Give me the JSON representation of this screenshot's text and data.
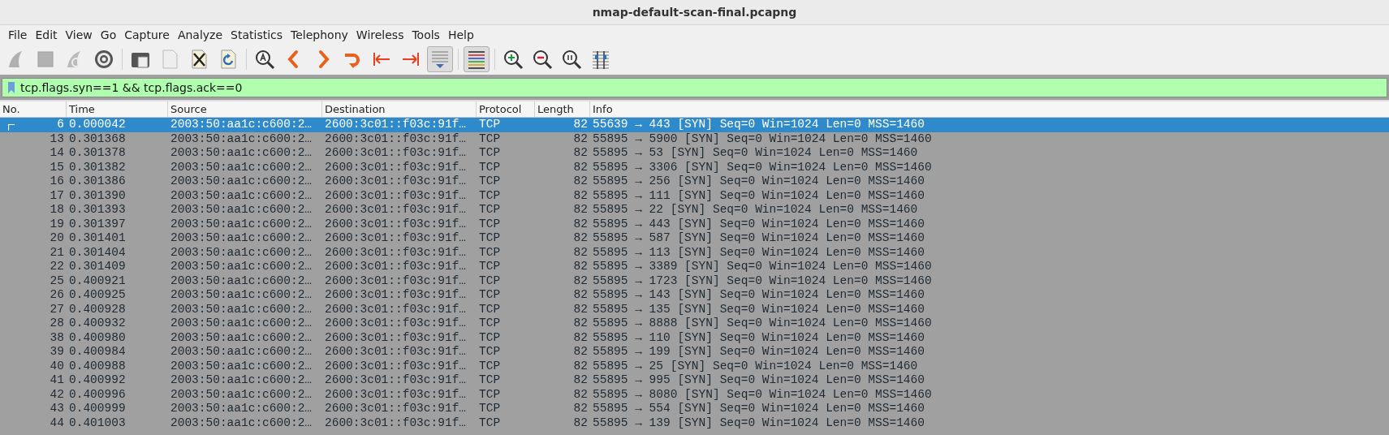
{
  "window": {
    "title": "nmap-default-scan-final.pcapng"
  },
  "menu": [
    "File",
    "Edit",
    "View",
    "Go",
    "Capture",
    "Analyze",
    "Statistics",
    "Telephony",
    "Wireless",
    "Tools",
    "Help"
  ],
  "toolbar": [
    [
      {
        "kind": "start",
        "disabled": true,
        "on": false
      },
      {
        "kind": "stop",
        "disabled": true,
        "on": false
      },
      {
        "kind": "restart",
        "disabled": true,
        "on": false
      },
      {
        "kind": "options",
        "disabled": false,
        "on": false
      }
    ],
    [
      {
        "kind": "open",
        "disabled": false,
        "on": false
      },
      {
        "kind": "save",
        "disabled": true,
        "on": false
      },
      {
        "kind": "close",
        "disabled": false,
        "on": false
      },
      {
        "kind": "reload",
        "disabled": false,
        "on": false
      }
    ],
    [
      {
        "kind": "find",
        "disabled": false,
        "on": false
      },
      {
        "kind": "back",
        "disabled": false,
        "on": false
      },
      {
        "kind": "forward",
        "disabled": false,
        "on": false
      },
      {
        "kind": "goto",
        "disabled": false,
        "on": false
      },
      {
        "kind": "first",
        "disabled": false,
        "on": false
      },
      {
        "kind": "last",
        "disabled": false,
        "on": false
      },
      {
        "kind": "autoscroll",
        "disabled": false,
        "on": true
      }
    ],
    [
      {
        "kind": "colorize",
        "disabled": false,
        "on": true
      }
    ],
    [
      {
        "kind": "zoom-in",
        "disabled": false,
        "on": false
      },
      {
        "kind": "zoom-out",
        "disabled": false,
        "on": false
      },
      {
        "kind": "zoom-normal",
        "disabled": false,
        "on": false
      },
      {
        "kind": "resize",
        "disabled": false,
        "on": false
      }
    ]
  ],
  "filter": {
    "value": "tcp.flags.syn==1 && tcp.flags.ack==0"
  },
  "table": {
    "columns": [
      "No.",
      "Time",
      "Source",
      "Destination",
      "Protocol",
      "Length",
      "Info"
    ],
    "rows": [
      {
        "selected": true,
        "cells": [
          "6",
          "0.000042",
          "2003:50:aa1c:c600:2…",
          "2600:3c01::f03c:91f…",
          "TCP",
          "82",
          "55639 → 443 [SYN] Seq=0 Win=1024 Len=0 MSS=1460"
        ]
      },
      {
        "selected": false,
        "cells": [
          "13",
          "0.301368",
          "2003:50:aa1c:c600:2…",
          "2600:3c01::f03c:91f…",
          "TCP",
          "82",
          "55895 → 5900 [SYN] Seq=0 Win=1024 Len=0 MSS=1460"
        ]
      },
      {
        "selected": false,
        "cells": [
          "14",
          "0.301378",
          "2003:50:aa1c:c600:2…",
          "2600:3c01::f03c:91f…",
          "TCP",
          "82",
          "55895 → 53 [SYN] Seq=0 Win=1024 Len=0 MSS=1460"
        ]
      },
      {
        "selected": false,
        "cells": [
          "15",
          "0.301382",
          "2003:50:aa1c:c600:2…",
          "2600:3c01::f03c:91f…",
          "TCP",
          "82",
          "55895 → 3306 [SYN] Seq=0 Win=1024 Len=0 MSS=1460"
        ]
      },
      {
        "selected": false,
        "cells": [
          "16",
          "0.301386",
          "2003:50:aa1c:c600:2…",
          "2600:3c01::f03c:91f…",
          "TCP",
          "82",
          "55895 → 256 [SYN] Seq=0 Win=1024 Len=0 MSS=1460"
        ]
      },
      {
        "selected": false,
        "cells": [
          "17",
          "0.301390",
          "2003:50:aa1c:c600:2…",
          "2600:3c01::f03c:91f…",
          "TCP",
          "82",
          "55895 → 111 [SYN] Seq=0 Win=1024 Len=0 MSS=1460"
        ]
      },
      {
        "selected": false,
        "cells": [
          "18",
          "0.301393",
          "2003:50:aa1c:c600:2…",
          "2600:3c01::f03c:91f…",
          "TCP",
          "82",
          "55895 → 22 [SYN] Seq=0 Win=1024 Len=0 MSS=1460"
        ]
      },
      {
        "selected": false,
        "cells": [
          "19",
          "0.301397",
          "2003:50:aa1c:c600:2…",
          "2600:3c01::f03c:91f…",
          "TCP",
          "82",
          "55895 → 443 [SYN] Seq=0 Win=1024 Len=0 MSS=1460"
        ]
      },
      {
        "selected": false,
        "cells": [
          "20",
          "0.301401",
          "2003:50:aa1c:c600:2…",
          "2600:3c01::f03c:91f…",
          "TCP",
          "82",
          "55895 → 587 [SYN] Seq=0 Win=1024 Len=0 MSS=1460"
        ]
      },
      {
        "selected": false,
        "cells": [
          "21",
          "0.301404",
          "2003:50:aa1c:c600:2…",
          "2600:3c01::f03c:91f…",
          "TCP",
          "82",
          "55895 → 113 [SYN] Seq=0 Win=1024 Len=0 MSS=1460"
        ]
      },
      {
        "selected": false,
        "cells": [
          "22",
          "0.301409",
          "2003:50:aa1c:c600:2…",
          "2600:3c01::f03c:91f…",
          "TCP",
          "82",
          "55895 → 3389 [SYN] Seq=0 Win=1024 Len=0 MSS=1460"
        ]
      },
      {
        "selected": false,
        "cells": [
          "25",
          "0.400921",
          "2003:50:aa1c:c600:2…",
          "2600:3c01::f03c:91f…",
          "TCP",
          "82",
          "55895 → 1723 [SYN] Seq=0 Win=1024 Len=0 MSS=1460"
        ]
      },
      {
        "selected": false,
        "cells": [
          "26",
          "0.400925",
          "2003:50:aa1c:c600:2…",
          "2600:3c01::f03c:91f…",
          "TCP",
          "82",
          "55895 → 143 [SYN] Seq=0 Win=1024 Len=0 MSS=1460"
        ]
      },
      {
        "selected": false,
        "cells": [
          "27",
          "0.400928",
          "2003:50:aa1c:c600:2…",
          "2600:3c01::f03c:91f…",
          "TCP",
          "82",
          "55895 → 135 [SYN] Seq=0 Win=1024 Len=0 MSS=1460"
        ]
      },
      {
        "selected": false,
        "cells": [
          "28",
          "0.400932",
          "2003:50:aa1c:c600:2…",
          "2600:3c01::f03c:91f…",
          "TCP",
          "82",
          "55895 → 8888 [SYN] Seq=0 Win=1024 Len=0 MSS=1460"
        ]
      },
      {
        "selected": false,
        "cells": [
          "38",
          "0.400980",
          "2003:50:aa1c:c600:2…",
          "2600:3c01::f03c:91f…",
          "TCP",
          "82",
          "55895 → 110 [SYN] Seq=0 Win=1024 Len=0 MSS=1460"
        ]
      },
      {
        "selected": false,
        "cells": [
          "39",
          "0.400984",
          "2003:50:aa1c:c600:2…",
          "2600:3c01::f03c:91f…",
          "TCP",
          "82",
          "55895 → 199 [SYN] Seq=0 Win=1024 Len=0 MSS=1460"
        ]
      },
      {
        "selected": false,
        "cells": [
          "40",
          "0.400988",
          "2003:50:aa1c:c600:2…",
          "2600:3c01::f03c:91f…",
          "TCP",
          "82",
          "55895 → 25 [SYN] Seq=0 Win=1024 Len=0 MSS=1460"
        ]
      },
      {
        "selected": false,
        "cells": [
          "41",
          "0.400992",
          "2003:50:aa1c:c600:2…",
          "2600:3c01::f03c:91f…",
          "TCP",
          "82",
          "55895 → 995 [SYN] Seq=0 Win=1024 Len=0 MSS=1460"
        ]
      },
      {
        "selected": false,
        "cells": [
          "42",
          "0.400996",
          "2003:50:aa1c:c600:2…",
          "2600:3c01::f03c:91f…",
          "TCP",
          "82",
          "55895 → 8080 [SYN] Seq=0 Win=1024 Len=0 MSS=1460"
        ]
      },
      {
        "selected": false,
        "cells": [
          "43",
          "0.400999",
          "2003:50:aa1c:c600:2…",
          "2600:3c01::f03c:91f…",
          "TCP",
          "82",
          "55895 → 554 [SYN] Seq=0 Win=1024 Len=0 MSS=1460"
        ]
      },
      {
        "selected": false,
        "cells": [
          "44",
          "0.401003",
          "2003:50:aa1c:c600:2…",
          "2600:3c01::f03c:91f…",
          "TCP",
          "82",
          "55895 → 139 [SYN] Seq=0 Win=1024 Len=0 MSS=1460"
        ]
      }
    ]
  }
}
